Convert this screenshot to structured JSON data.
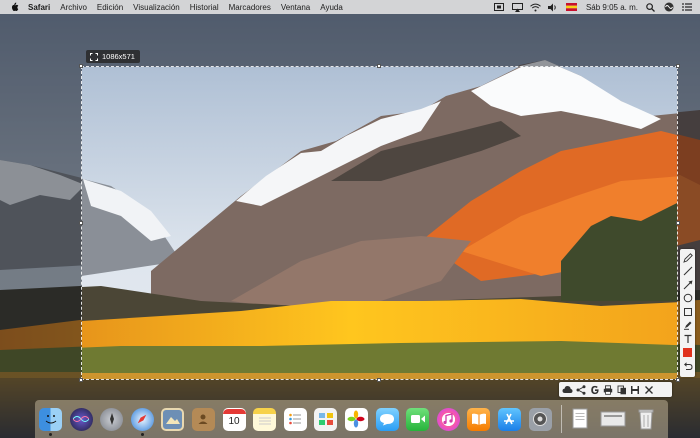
{
  "menubar": {
    "app_name": "Safari",
    "items": [
      "Archivo",
      "Edición",
      "Visualización",
      "Historial",
      "Marcadores",
      "Ventana",
      "Ayuda"
    ],
    "clock": "Sáb 9:05 a. m."
  },
  "selection": {
    "size_label": "1086x571"
  },
  "vertical_tools": [
    "pen-icon",
    "line-icon",
    "arrow-icon",
    "ellipse-icon",
    "rectangle-icon",
    "marker-icon",
    "text-icon",
    "color-swatch",
    "undo-icon"
  ],
  "horizontal_tools": [
    "upload-cloud-icon",
    "share-icon",
    "google-search-icon",
    "print-icon",
    "copy-icon",
    "save-icon",
    "close-icon"
  ],
  "colors": {
    "annotation_color": "#e0321e",
    "menubar_bg": "#dedee0"
  },
  "dock": {
    "apps": [
      "finder",
      "siri",
      "launchpad",
      "safari",
      "photo-viewer",
      "contacts",
      "calendar",
      "notes",
      "reminders",
      "photo-booth",
      "photos",
      "messages",
      "facetime",
      "itunes",
      "ibooks",
      "app-store",
      "system-preferences"
    ],
    "calendar_day": "10",
    "trailing": [
      "documents-stack",
      "downloads-stack",
      "trash"
    ]
  }
}
